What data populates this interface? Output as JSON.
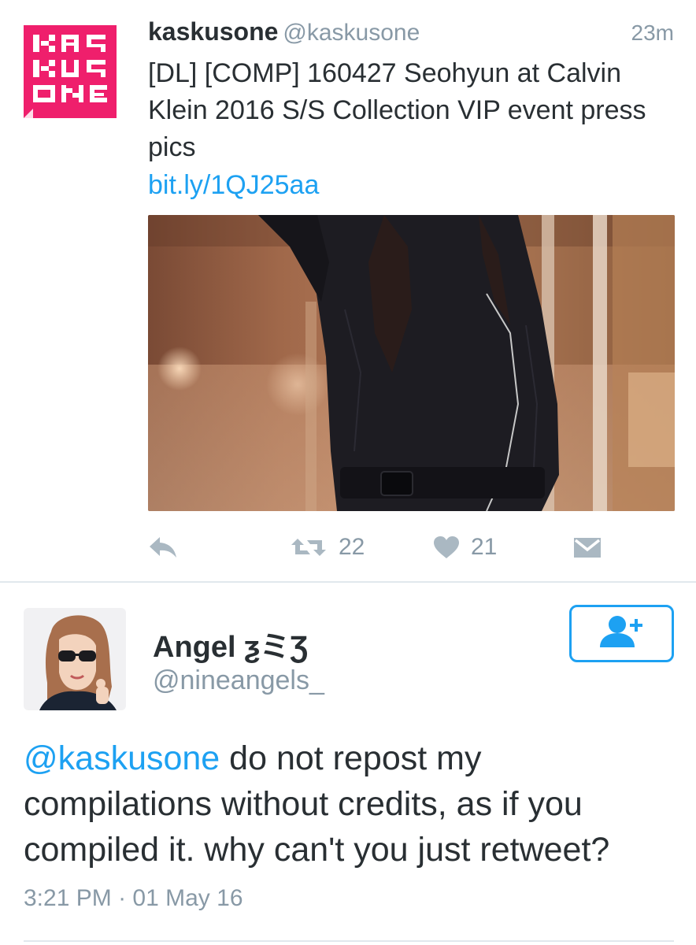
{
  "tweet": {
    "display_name": "kaskusone",
    "screen_name": "@kaskusone",
    "timestamp": "23m",
    "text": "[DL] [COMP] 160427 Seohyun at Calvin Klein 2016 S/S Collection VIP event press pics",
    "link": "bit.ly/1QJ25aa",
    "logo_letters": "KASKUSONE",
    "actions": {
      "reply_icon": "reply-icon",
      "retweet_icon": "retweet-icon",
      "retweet_count": "22",
      "like_icon": "heart-icon",
      "like_count": "21",
      "dm_icon": "envelope-icon"
    }
  },
  "reply": {
    "display_name": "Angel ƺミƷ",
    "screen_name": "@nineangels_",
    "mention": "@kaskusone",
    "text": " do not repost my compilations without credits, as if you compiled it. why can't you just retweet?",
    "time": "3:21 PM",
    "separator": "·",
    "date": "01 May 16",
    "follow_icon": "add-user-icon"
  },
  "colors": {
    "brand_pink": "#ef1f6c",
    "link_blue": "#1da1f2",
    "muted_gray": "#8899a6",
    "text_dark": "#292f33",
    "divider": "#e1e8ed"
  }
}
